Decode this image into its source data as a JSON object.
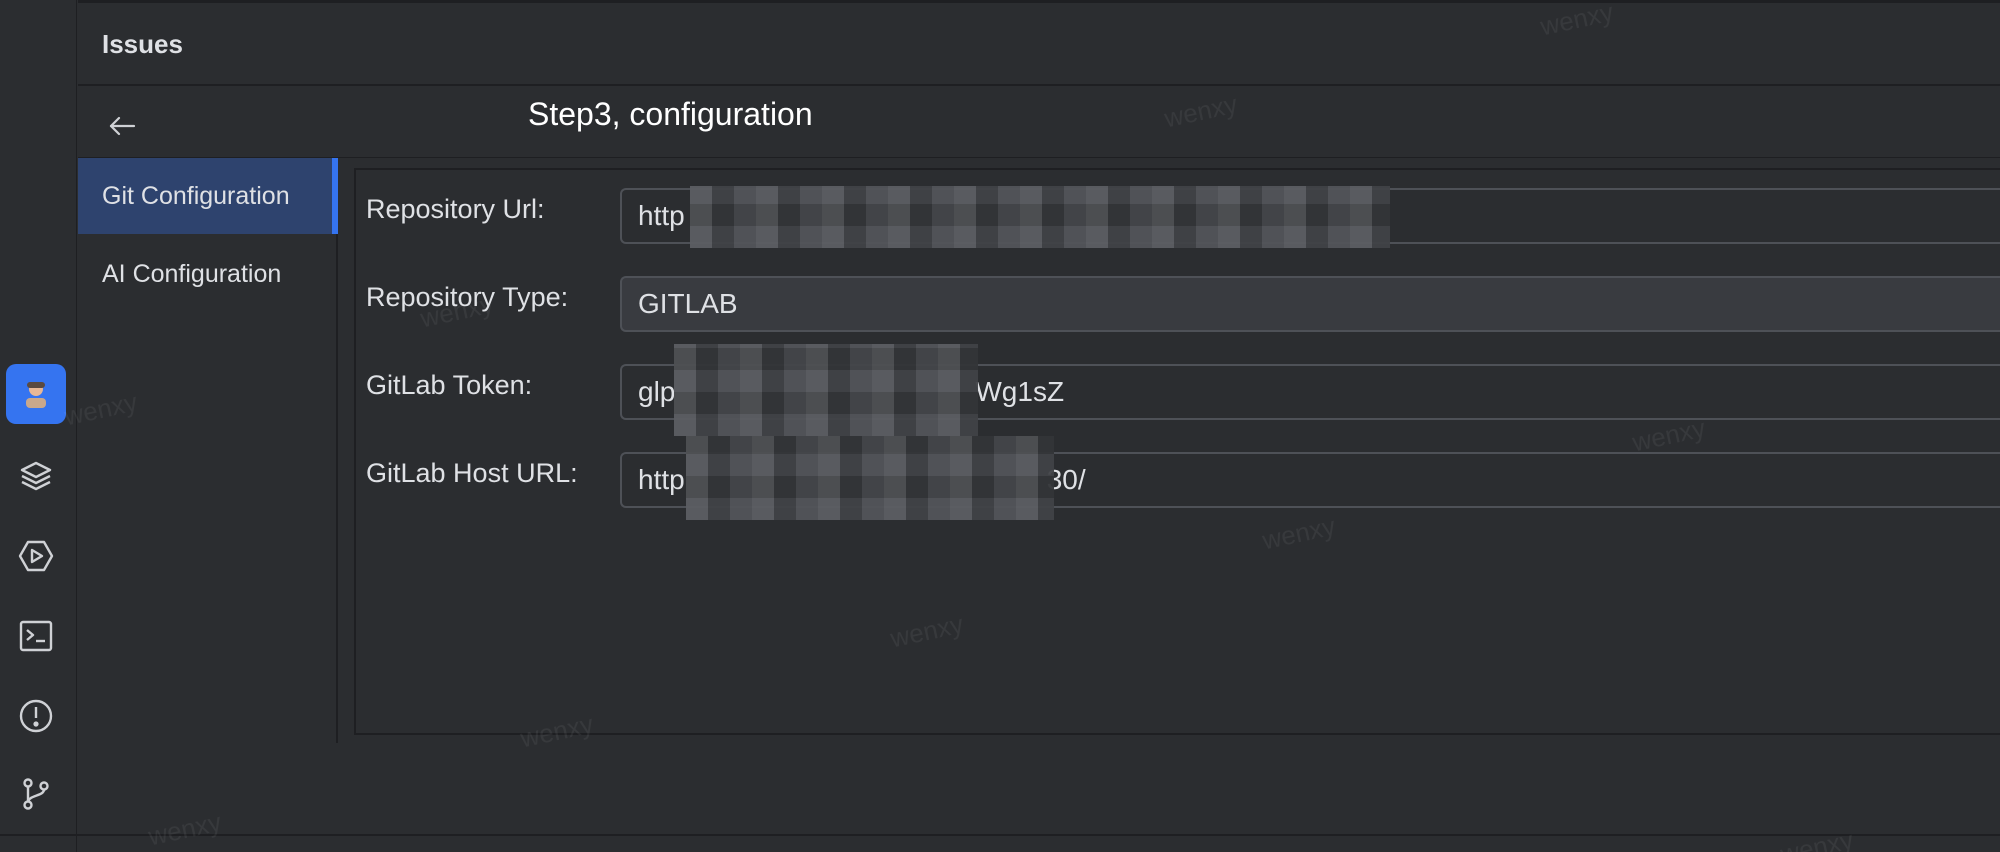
{
  "header": {
    "title": "Issues"
  },
  "subbar": {
    "step_title": "Step3, configuration"
  },
  "nav": {
    "items": [
      {
        "label": "Git Configuration",
        "selected": true
      },
      {
        "label": "AI  Configuration",
        "selected": false
      }
    ]
  },
  "form": {
    "repository_url": {
      "label": "Repository Url:",
      "value": "http"
    },
    "repository_type": {
      "label": "Repository Type:",
      "value": "GITLAB"
    },
    "gitlab_token": {
      "label": "GitLab Token:",
      "value_start": "glp",
      "value_end": "Wg1sZ"
    },
    "gitlab_host_url": {
      "label": "GitLab Host URL:",
      "value_start": "http",
      "value_end": "30/"
    }
  },
  "watermark": {
    "text": "wenxy"
  },
  "tool_strip": {
    "icons": [
      "avatar-icon",
      "layers-icon",
      "run-icon",
      "terminal-icon",
      "problems-icon",
      "git-branch-icon"
    ]
  },
  "colors": {
    "accent": "#3574f0",
    "background": "#2b2d30",
    "selected_nav": "#2e436e"
  }
}
